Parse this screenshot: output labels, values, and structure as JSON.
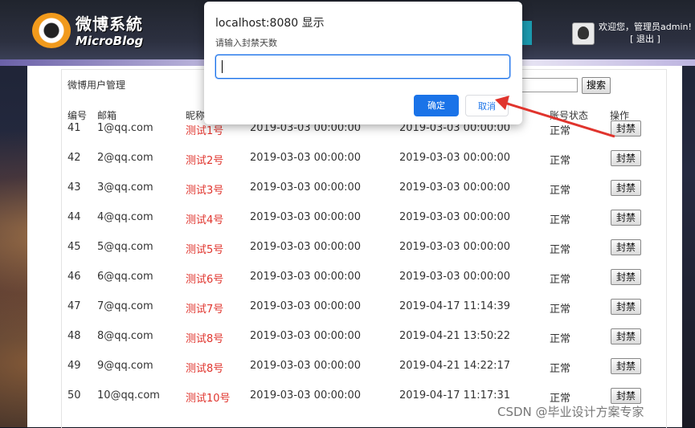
{
  "header": {
    "logo_title": "微博系統",
    "logo_sub": "MicroBlog",
    "welcome_line1": "欢迎您，管理员admin!",
    "logout": "[ 退出 ]"
  },
  "section": {
    "title": "微博用户管理",
    "search_label": "搜索"
  },
  "table": {
    "headers": [
      "编号",
      "邮箱",
      "昵称",
      "账号状态",
      "操作"
    ],
    "rows": [
      {
        "id": "41",
        "email": "1@qq.com",
        "nick": "测试1号",
        "created": "2019-03-03 00:00:00",
        "updated": "2019-03-03 00:00:00",
        "status": "正常",
        "action": "封禁"
      },
      {
        "id": "42",
        "email": "2@qq.com",
        "nick": "测试2号",
        "created": "2019-03-03 00:00:00",
        "updated": "2019-03-03 00:00:00",
        "status": "正常",
        "action": "封禁"
      },
      {
        "id": "43",
        "email": "3@qq.com",
        "nick": "测试3号",
        "created": "2019-03-03 00:00:00",
        "updated": "2019-03-03 00:00:00",
        "status": "正常",
        "action": "封禁"
      },
      {
        "id": "44",
        "email": "4@qq.com",
        "nick": "测试4号",
        "created": "2019-03-03 00:00:00",
        "updated": "2019-03-03 00:00:00",
        "status": "正常",
        "action": "封禁"
      },
      {
        "id": "45",
        "email": "5@qq.com",
        "nick": "测试5号",
        "created": "2019-03-03 00:00:00",
        "updated": "2019-03-03 00:00:00",
        "status": "正常",
        "action": "封禁"
      },
      {
        "id": "46",
        "email": "6@qq.com",
        "nick": "测试6号",
        "created": "2019-03-03 00:00:00",
        "updated": "2019-03-03 00:00:00",
        "status": "正常",
        "action": "封禁"
      },
      {
        "id": "47",
        "email": "7@qq.com",
        "nick": "测试7号",
        "created": "2019-03-03 00:00:00",
        "updated": "2019-04-17 11:14:39",
        "status": "正常",
        "action": "封禁"
      },
      {
        "id": "48",
        "email": "8@qq.com",
        "nick": "测试8号",
        "created": "2019-03-03 00:00:00",
        "updated": "2019-04-21 13:50:22",
        "status": "正常",
        "action": "封禁"
      },
      {
        "id": "49",
        "email": "9@qq.com",
        "nick": "测试8号",
        "created": "2019-03-03 00:00:00",
        "updated": "2019-04-21 14:22:17",
        "status": "正常",
        "action": "封禁"
      },
      {
        "id": "50",
        "email": "10@qq.com",
        "nick": "测试10号",
        "created": "2019-03-03 00:00:00",
        "updated": "2019-04-17 11:17:31",
        "status": "正常",
        "action": "封禁"
      }
    ]
  },
  "dialog": {
    "title": "localhost:8080 显示",
    "message": "请输入封禁天数",
    "input_value": "",
    "ok_label": "确定",
    "cancel_label": "取消"
  },
  "watermark": "CSDN @毕业设计方案专家",
  "colors": {
    "accent": "#1a73e8",
    "nick_red": "#e0342d",
    "annotation_arrow": "#e0342d"
  }
}
